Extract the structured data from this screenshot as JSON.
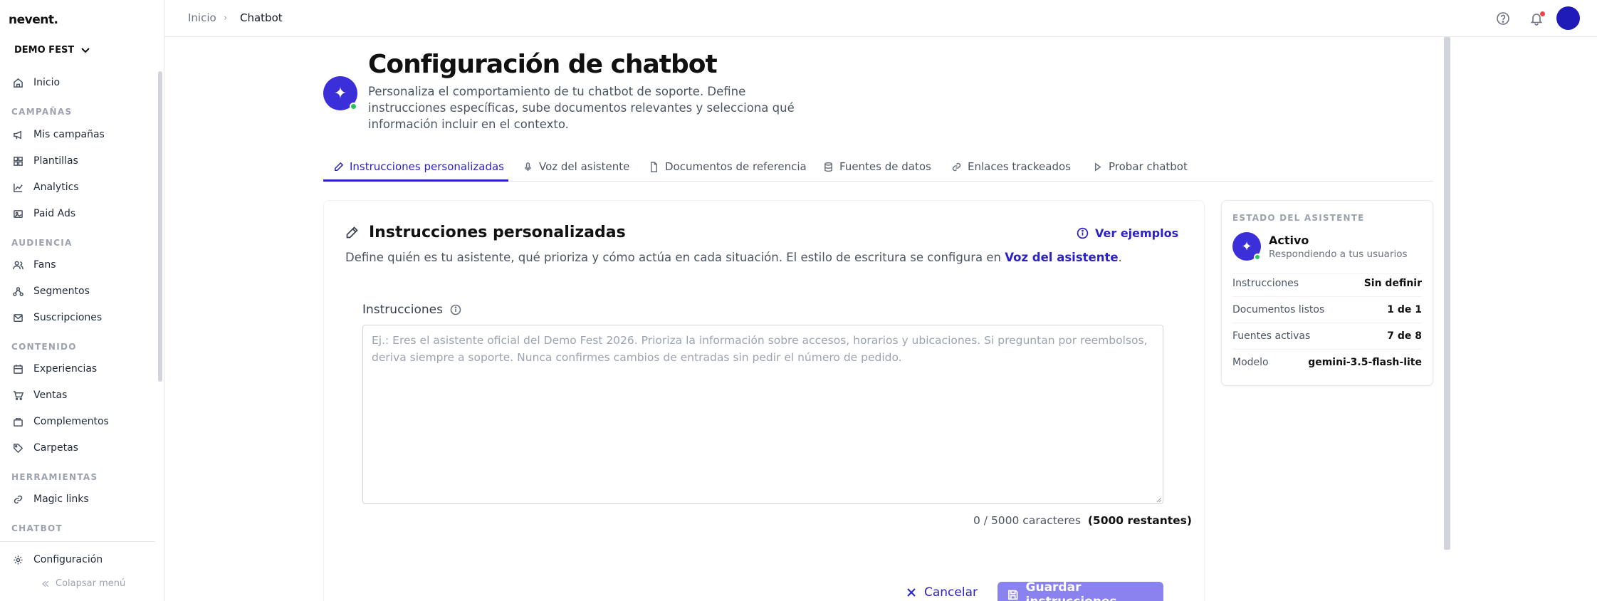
{
  "app": {
    "logo": "nevent.",
    "org": "DEMO FEST"
  },
  "breadcrumb": {
    "home": "Inicio",
    "separator": "›",
    "current": "Chatbot"
  },
  "sidebar": {
    "items": [
      {
        "label": "Inicio",
        "icon": "home-icon"
      },
      {
        "section": "CAMPAÑAS"
      },
      {
        "label": "Mis campañas",
        "icon": "megaphone-icon"
      },
      {
        "label": "Plantillas",
        "icon": "grid-icon"
      },
      {
        "label": "Analytics",
        "icon": "chart-icon"
      },
      {
        "label": "Paid Ads",
        "icon": "image-icon"
      },
      {
        "section": "AUDIENCIA"
      },
      {
        "label": "Fans",
        "icon": "users-icon"
      },
      {
        "label": "Segmentos",
        "icon": "segments-icon"
      },
      {
        "label": "Suscripciones",
        "icon": "mail-icon"
      },
      {
        "section": "CONTENIDO"
      },
      {
        "label": "Experiencias",
        "icon": "calendar-icon"
      },
      {
        "label": "Ventas",
        "icon": "cart-icon"
      },
      {
        "label": "Complementos",
        "icon": "bag-icon"
      },
      {
        "label": "Carpetas",
        "icon": "tag-icon"
      },
      {
        "section": "HERRAMIENTAS"
      },
      {
        "label": "Magic links",
        "icon": "link-icon"
      },
      {
        "section": "CHATBOT"
      }
    ],
    "settings": "Configuración",
    "collapse": "Colapsar menú"
  },
  "header": {
    "title": "Configuración de chatbot",
    "description": "Personaliza el comportamiento de tu chatbot de soporte. Define instrucciones específicas, sube documentos relevantes y selecciona qué información incluir en el contexto."
  },
  "tabs": [
    {
      "label": "Instrucciones personalizadas",
      "icon": "pencil-icon",
      "active": true
    },
    {
      "label": "Voz del asistente",
      "icon": "mic-icon"
    },
    {
      "label": "Documentos de referencia",
      "icon": "document-icon"
    },
    {
      "label": "Fuentes de datos",
      "icon": "database-icon"
    },
    {
      "label": "Enlaces trackeados",
      "icon": "link-icon"
    },
    {
      "label": "Probar chatbot",
      "icon": "play-icon"
    }
  ],
  "card": {
    "title": "Instrucciones personalizadas",
    "examples": "Ver ejemplos",
    "desc_prefix": "Define quién es tu asistente, qué prioriza y cómo actúa en cada situación. El estilo de escritura se configura en ",
    "desc_link": "Voz del asistente",
    "desc_suffix": ".",
    "field_label": "Instrucciones",
    "textarea_value": "",
    "textarea_placeholder": "Ej.: Eres el asistente oficial del Demo Fest 2026. Prioriza la información sobre accesos, horarios y ubicaciones. Si preguntan por reembolsos, deriva siempre a soporte. Nunca confirmes cambios de entradas sin pedir el número de pedido.",
    "counter": "0 / 5000 caracteres",
    "remaining": "(5000 restantes)",
    "cancel": "Cancelar",
    "save": "Guardar instrucciones"
  },
  "status": {
    "title": "ESTADO DEL ASISTENTE",
    "name": "Activo",
    "subtitle": "Respondiendo a tus usuarios",
    "rows": [
      {
        "key": "Instrucciones",
        "value": "Sin definir"
      },
      {
        "key": "Documentos listos",
        "value": "1 de 1"
      },
      {
        "key": "Fuentes activas",
        "value": "7 de 8"
      },
      {
        "key": "Modelo",
        "value": "gemini-3.5-flash-lite"
      }
    ]
  },
  "colors": {
    "accent": "#2b21c8",
    "brand_icon": "#3b2fd9",
    "online": "#22c55e",
    "notification": "#ef4444",
    "save_disabled": "#8a82ee"
  }
}
